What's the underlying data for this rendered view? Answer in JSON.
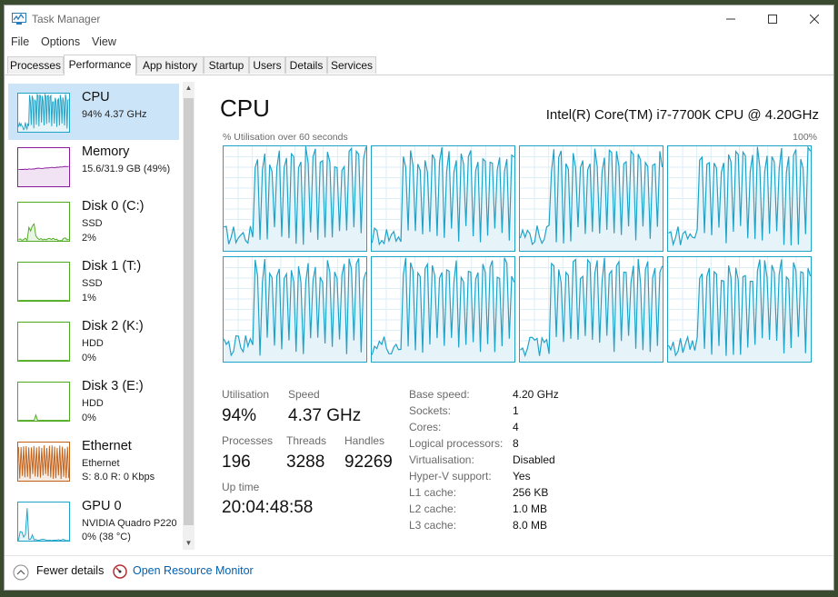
{
  "window": {
    "title": "Task Manager",
    "icon": "task-manager-icon"
  },
  "menu": [
    "File",
    "Options",
    "View"
  ],
  "tabs": [
    "Processes",
    "Performance",
    "App history",
    "Startup",
    "Users",
    "Details",
    "Services"
  ],
  "active_tab": "Performance",
  "resources": [
    {
      "title": "CPU",
      "sub1": "94%  4.37 GHz",
      "sub2": "",
      "sub3": "",
      "color": "#1fa2c8",
      "utilization": 94
    },
    {
      "title": "Memory",
      "sub1": "15.6/31.9 GB (49%)",
      "sub2": "",
      "sub3": "",
      "color": "#8b1a9e",
      "utilization": 49
    },
    {
      "title": "Disk 0 (C:)",
      "sub1": "SSD",
      "sub2": "2%",
      "sub3": "",
      "color": "#4daa1e",
      "utilization": 2
    },
    {
      "title": "Disk 1 (T:)",
      "sub1": "SSD",
      "sub2": "1%",
      "sub3": "",
      "color": "#4daa1e",
      "utilization": 1
    },
    {
      "title": "Disk 2 (K:)",
      "sub1": "HDD",
      "sub2": "0%",
      "sub3": "",
      "color": "#4daa1e",
      "utilization": 0
    },
    {
      "title": "Disk 3 (E:)",
      "sub1": "HDD",
      "sub2": "0%",
      "sub3": "",
      "color": "#4daa1e",
      "utilization": 0
    },
    {
      "title": "Ethernet",
      "sub1": "Ethernet",
      "sub2": "S: 8.0  R: 0 Kbps",
      "sub3": "",
      "color": "#c06018",
      "utilization": 10
    },
    {
      "title": "GPU 0",
      "sub1": "NVIDIA Quadro P220",
      "sub2": "0% (38 °C)",
      "sub3": "",
      "color": "#1fa2c8",
      "utilization": 0
    }
  ],
  "detail": {
    "title": "CPU",
    "model": "Intel(R) Core(TM) i7-7700K CPU @ 4.20GHz",
    "graph_label": "% Utilisation over 60 seconds",
    "graph_max": "100%",
    "core_count": 8,
    "stats": {
      "utilisation_label": "Utilisation",
      "utilisation": "94%",
      "speed_label": "Speed",
      "speed": "4.37 GHz",
      "processes_label": "Processes",
      "processes": "196",
      "threads_label": "Threads",
      "threads": "3288",
      "handles_label": "Handles",
      "handles": "92269",
      "uptime_label": "Up time",
      "uptime": "20:04:48:58"
    },
    "specs": [
      {
        "key": "Base speed:",
        "value": "4.20 GHz"
      },
      {
        "key": "Sockets:",
        "value": "1"
      },
      {
        "key": "Cores:",
        "value": "4"
      },
      {
        "key": "Logical processors:",
        "value": "8"
      },
      {
        "key": "Virtualisation:",
        "value": "Disabled"
      },
      {
        "key": "Hyper-V support:",
        "value": "Yes"
      },
      {
        "key": "L1 cache:",
        "value": "256 KB"
      },
      {
        "key": "L2 cache:",
        "value": "1.0 MB"
      },
      {
        "key": "L3 cache:",
        "value": "8.0 MB"
      }
    ]
  },
  "footer": {
    "fewer_details": "Fewer details",
    "open_resource_monitor": "Open Resource Monitor"
  },
  "colors": {
    "accent": "#1fa2c8",
    "selected_bg": "#cce4f7",
    "link": "#0060b0"
  }
}
